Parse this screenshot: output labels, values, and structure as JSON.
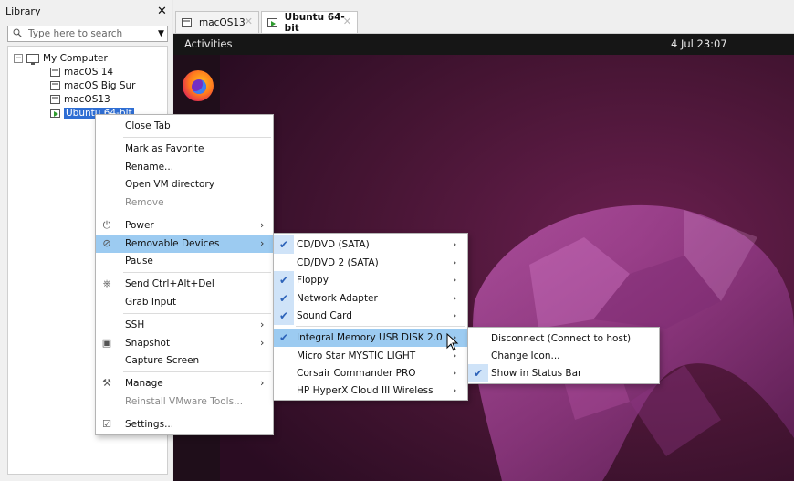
{
  "library": {
    "title": "Library",
    "close_glyph": "✕",
    "search_placeholder": "Type here to search",
    "tree": {
      "root_label": "My Computer",
      "expander": "−",
      "items": [
        "macOS 14",
        "macOS Big Sur",
        "macOS13",
        "Ubuntu 64-bit"
      ]
    }
  },
  "tabs": [
    {
      "label": "macOS13",
      "close": "✕"
    },
    {
      "label": "Ubuntu 64-bit",
      "close": "✕"
    }
  ],
  "vm": {
    "activities": "Activities",
    "clock": "4 Jul  23:07",
    "dock_icon": "firefox-icon"
  },
  "context_menu": {
    "items": [
      {
        "label": "Close Tab"
      },
      {
        "label": "Mark as Favorite"
      },
      {
        "label": "Rename..."
      },
      {
        "label": "Open VM directory"
      },
      {
        "label": "Remove",
        "disabled": true
      },
      {
        "label": "Power",
        "submenu": true,
        "icon": "power-icon"
      },
      {
        "label": "Removable Devices",
        "submenu": true,
        "icon": "removable-devices-icon",
        "highlighted": true
      },
      {
        "label": "Pause"
      },
      {
        "label": "Send Ctrl+Alt+Del",
        "icon": "send-keys-icon"
      },
      {
        "label": "Grab Input"
      },
      {
        "label": "SSH",
        "submenu": true
      },
      {
        "label": "Snapshot",
        "submenu": true,
        "icon": "snapshot-icon"
      },
      {
        "label": "Capture Screen"
      },
      {
        "label": "Manage",
        "submenu": true,
        "icon": "wrench-icon"
      },
      {
        "label": "Reinstall VMware Tools...",
        "disabled": true
      },
      {
        "label": "Settings...",
        "icon": "settings-icon"
      }
    ],
    "arrow_glyph": "›"
  },
  "removable_devices_menu": {
    "items": [
      {
        "label": "CD/DVD (SATA)",
        "checked": true
      },
      {
        "label": "CD/DVD 2 (SATA)",
        "checked": false
      },
      {
        "label": "Floppy",
        "checked": true
      },
      {
        "label": "Network Adapter",
        "checked": true
      },
      {
        "label": "Sound Card",
        "checked": true
      },
      {
        "label": "Integral Memory USB DISK 2.0",
        "checked": true,
        "highlighted": true
      },
      {
        "label": "Micro Star MYSTIC LIGHT",
        "checked": false
      },
      {
        "label": "Corsair Commander PRO",
        "checked": false
      },
      {
        "label": "HP HyperX Cloud III Wireless",
        "checked": false
      }
    ],
    "check_glyph": "✔"
  },
  "usb_menu": {
    "items": [
      {
        "label": "Disconnect (Connect to host)",
        "checked": false
      },
      {
        "label": "Change Icon...",
        "checked": false
      },
      {
        "label": "Show in Status Bar",
        "checked": true
      }
    ]
  },
  "colors": {
    "selection": "#2f6ed3",
    "menu_highlight": "#9ccbf1",
    "check": "#2d63b9",
    "wallpaper_dark": "#321029",
    "wallpaper_accent": "#b04aa8"
  }
}
